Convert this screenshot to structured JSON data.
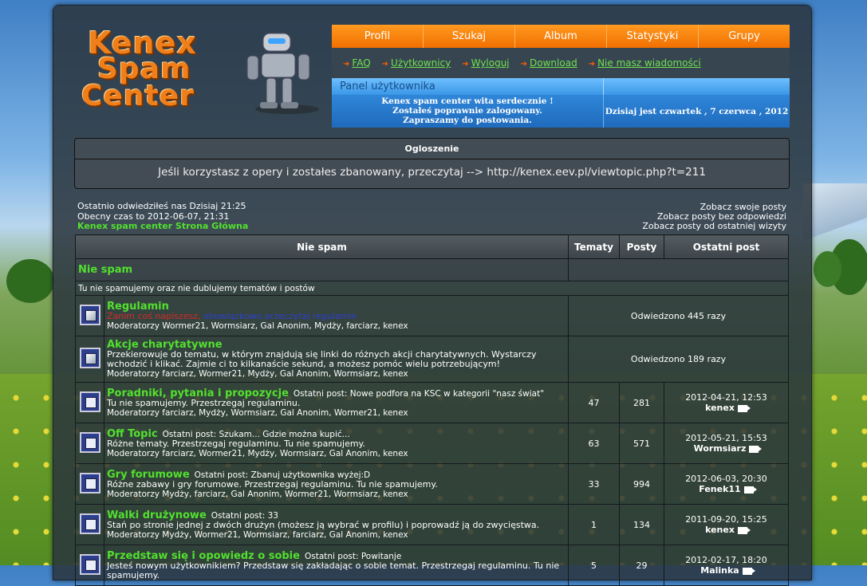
{
  "logo": {
    "line1": "Kenex",
    "line2": "Spam",
    "line3": "Center"
  },
  "nav": [
    "Profil",
    "Szukaj",
    "Album",
    "Statystyki",
    "Grupy"
  ],
  "links": [
    "FAQ",
    "Użytkownicy",
    "Wyloguj",
    "Download",
    "Nie masz wiadomości"
  ],
  "userpanel": {
    "title": "Panel użytkownika",
    "welcome1": "Kenex spam center wita serdecznie !",
    "welcome2": "Zostałeś poprawnie zalogowany.",
    "welcome3": "Zapraszamy do postowania.",
    "date": "Dzisiaj jest czwartek , 7 czerwca , 2012"
  },
  "announcement": {
    "title": "Ogloszenie",
    "message": "Jeśli korzystasz z opery i zostałes zbanowany, przeczytaj --> http://kenex.eev.pl/viewtopic.php?t=211"
  },
  "info": {
    "last_visit": "Ostatnio odwiedziłeś nas Dzisiaj 21:25",
    "current_time": "Obecny czas to 2012-06-07, 21:31",
    "home": "Kenex spam center Strona Główna",
    "own_posts": "Zobacz swoje posty",
    "unanswered": "Zobacz posty bez odpowiedzi",
    "since_last": "Zobacz posty od ostatniej wizyty"
  },
  "table": {
    "h_forum": "Nie spam",
    "h_topics": "Tematy",
    "h_posts": "Posty",
    "h_last": "Ostatni post",
    "category": "Nie spam",
    "category_desc": "Tu nie spamujemy oraz nie dublujemy tematów i postów"
  },
  "forums": [
    {
      "title": "Regulamin",
      "lastpost": "",
      "desc_red": "Zanim coś napiszesz, ",
      "desc_blue": "obowiązkowo przeczytaj regulamin",
      "desc": "",
      "mods": "Moderatorzy Wormer21, Wormsiarz, Gal Anonim, Mydży, farciarz, kenex",
      "visited": "Odwiedzono 445 razy"
    },
    {
      "title": "Akcje charytatywne",
      "lastpost": "",
      "desc": "Przekierowuje do tematu, w którym znajdują się linki do różnych akcji charytatywnych. Wystarczy wchodzić i klikać. Zajmie ci to kilkanaście sekund, a możesz pomóc wielu potrzebującym!",
      "mods": "Moderatorzy farciarz, Wormer21, Mydży, Gal Anonim, Wormsiarz, kenex",
      "visited": "Odwiedzono 189 razy"
    },
    {
      "title": "Poradniki, pytania i propozycje",
      "lastpost": "Ostatni post: Nowe podfora na KSC w kategorii \"nasz świat\"",
      "desc": "Tu nie spamujemy. Przestrzegaj regulaminu.",
      "mods": "Moderatorzy farciarz, Mydży, Wormsiarz, Gal Anonim, Wormer21, kenex",
      "topics": "47",
      "posts": "281",
      "date": "2012-04-21, 12:53",
      "user": "kenex"
    },
    {
      "title": "Off Topic",
      "lastpost": "Ostatni post: Szukam... Gdzie można kupić...",
      "desc": "Różne tematy. Przestrzegaj regulaminu. Tu nie spamujemy.",
      "mods": "Moderatorzy farciarz, Wormer21, Mydży, Wormsiarz, Gal Anonim, kenex",
      "topics": "63",
      "posts": "571",
      "date": "2012-05-21, 15:53",
      "user": "Wormsiarz"
    },
    {
      "title": "Gry forumowe",
      "lastpost": "Ostatni post: Zbanuj użytkownika wyżej:D",
      "desc": "Różne zabawy i gry forumowe. Przestrzegaj regulaminu. Tu nie spamujemy.",
      "mods": "Moderatorzy Mydży, farciarz, Gal Anonim, Wormer21, Wormsiarz, kenex",
      "topics": "33",
      "posts": "994",
      "date": "2012-06-03, 20:30",
      "user": "Fenek11"
    },
    {
      "title": "Walki drużynowe",
      "lastpost": "Ostatni post: 33",
      "desc": "Stań po stronie jednej z dwóch drużyn (możesz ją wybrać w profilu) i poprowadź ją do zwycięstwa.",
      "mods": "Moderatorzy Mydży, Wormer21, Wormsiarz, farciarz, Gal Anonim, kenex",
      "topics": "1",
      "posts": "134",
      "date": "2011-09-20, 15:25",
      "user": "kenex"
    },
    {
      "title": "Przedstaw się i opowiedz o sobie",
      "lastpost": "Ostatni post: Powitanje",
      "desc": "Jesteś nowym użytkownikiem? Przedstaw się zakładając o sobie temat. Przestrzegaj regulaminu. Tu nie spamujemy.",
      "mods": "",
      "topics": "5",
      "posts": "29",
      "date": "2012-02-17, 18:20",
      "user": "Malinka"
    }
  ]
}
